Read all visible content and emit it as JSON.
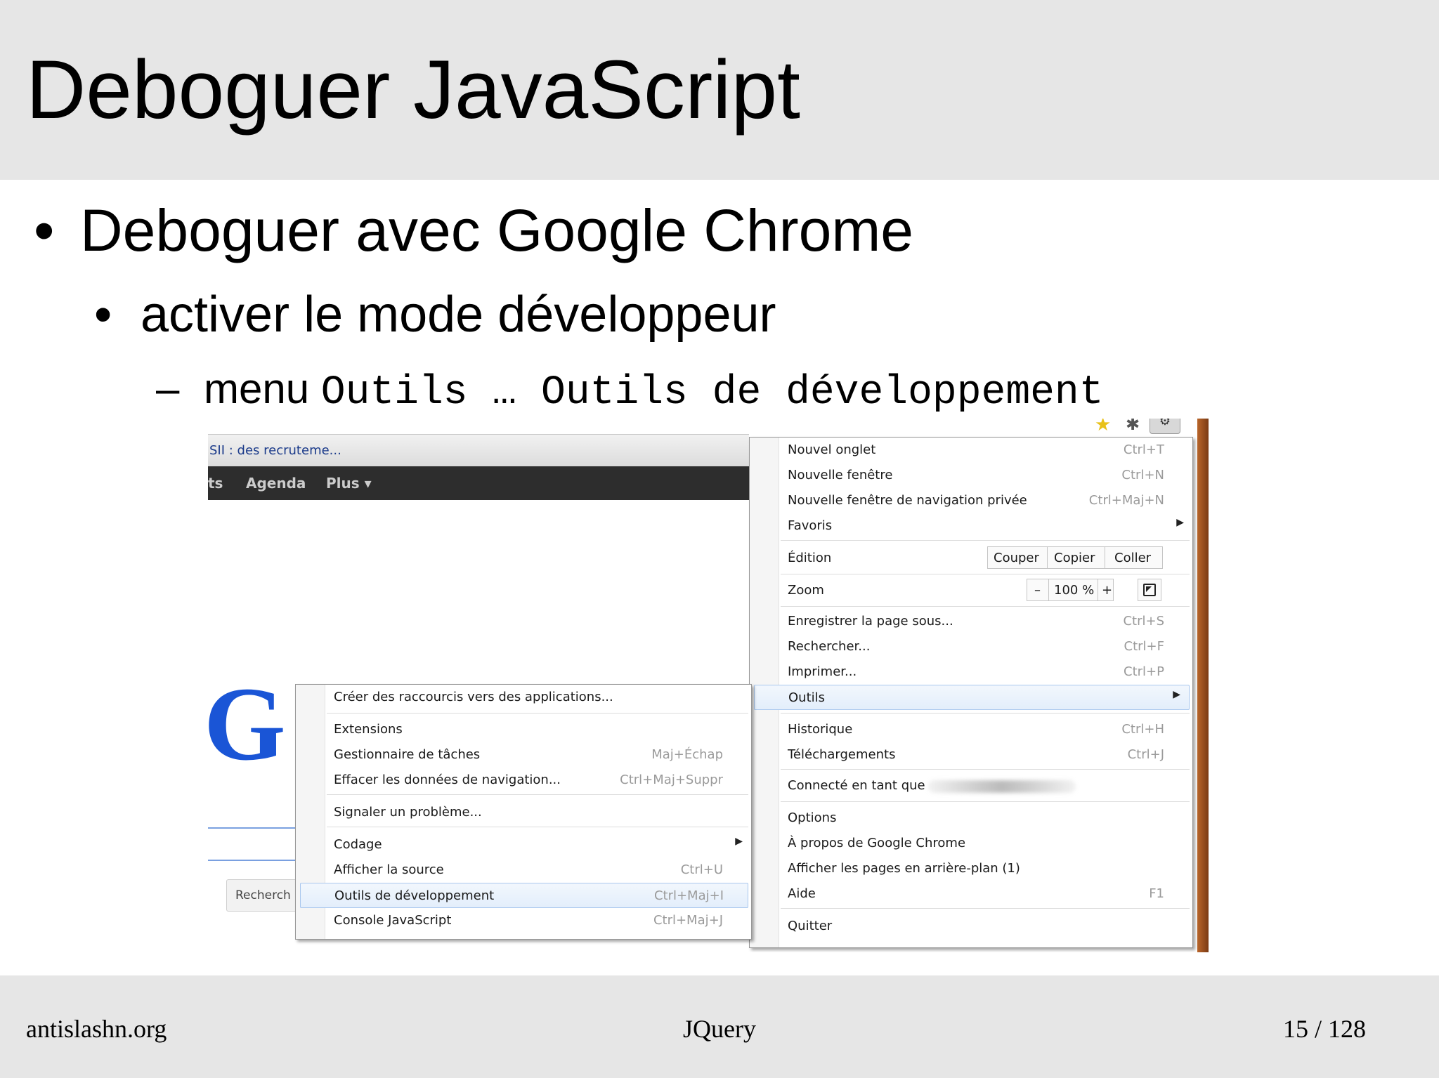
{
  "slide": {
    "title": "Deboguer JavaScript",
    "bullet1": {
      "marker": "•",
      "text": "Deboguer avec Google Chrome"
    },
    "bullet2": {
      "marker": "•",
      "text": "activer le mode développeur"
    },
    "bullet3": {
      "marker": "–",
      "prefix": "menu",
      "code": "Outils … Outils de développement"
    }
  },
  "footer": {
    "left": "antislashn.org",
    "center": "JQuery",
    "right": "15 / 128"
  },
  "browser": {
    "tab_title": "SII : des recruteme...",
    "google_bar": [
      "ts",
      "Agenda",
      "Plus ▾"
    ],
    "search_button": "Recherch",
    "google_letter": "G",
    "icons": {
      "star": "star-icon",
      "bug": "bug-icon",
      "wrench": "wrench-icon"
    },
    "colors": {
      "google_bar": "#2d2d2d",
      "google_blue": "#1a55d6",
      "menu_highlight": "#e3eefb"
    }
  },
  "main_menu": {
    "items": [
      {
        "label": "Nouvel onglet",
        "shortcut": "Ctrl+T"
      },
      {
        "label": "Nouvelle fenêtre",
        "shortcut": "Ctrl+N"
      },
      {
        "label": "Nouvelle fenêtre de navigation privée",
        "shortcut": "Ctrl+Maj+N"
      },
      {
        "label": "Favoris",
        "shortcut": ""
      },
      {
        "label": "Édition",
        "shortcut": ""
      },
      {
        "label": "Zoom",
        "shortcut": ""
      },
      {
        "label": "Enregistrer la page sous...",
        "shortcut": "Ctrl+S"
      },
      {
        "label": "Rechercher...",
        "shortcut": "Ctrl+F"
      },
      {
        "label": "Imprimer...",
        "shortcut": "Ctrl+P"
      },
      {
        "label": "Outils",
        "shortcut": ""
      },
      {
        "label": "Historique",
        "shortcut": "Ctrl+H"
      },
      {
        "label": "Téléchargements",
        "shortcut": "Ctrl+J"
      },
      {
        "label": "Connecté en tant que",
        "shortcut": ""
      },
      {
        "label": "Options",
        "shortcut": ""
      },
      {
        "label": "À propos de Google Chrome",
        "shortcut": ""
      },
      {
        "label": "Afficher les pages en arrière-plan (1)",
        "shortcut": ""
      },
      {
        "label": "Aide",
        "shortcut": "F1"
      },
      {
        "label": "Quitter",
        "shortcut": ""
      }
    ],
    "edit_buttons": {
      "cut": "Couper",
      "copy": "Copier",
      "paste": "Coller"
    },
    "zoom": {
      "minus": "–",
      "value": "100 %",
      "plus": "+"
    }
  },
  "tools_submenu": {
    "items": [
      {
        "label": "Créer des raccourcis vers des applications...",
        "shortcut": ""
      },
      {
        "label": "Extensions",
        "shortcut": ""
      },
      {
        "label": "Gestionnaire de tâches",
        "shortcut": "Maj+Échap"
      },
      {
        "label": "Effacer les données de navigation...",
        "shortcut": "Ctrl+Maj+Suppr"
      },
      {
        "label": "Signaler un problème...",
        "shortcut": ""
      },
      {
        "label": "Codage",
        "shortcut": ""
      },
      {
        "label": "Afficher la source",
        "shortcut": "Ctrl+U"
      },
      {
        "label": "Outils de développement",
        "shortcut": "Ctrl+Maj+I"
      },
      {
        "label": "Console JavaScript",
        "shortcut": "Ctrl+Maj+J"
      }
    ]
  }
}
